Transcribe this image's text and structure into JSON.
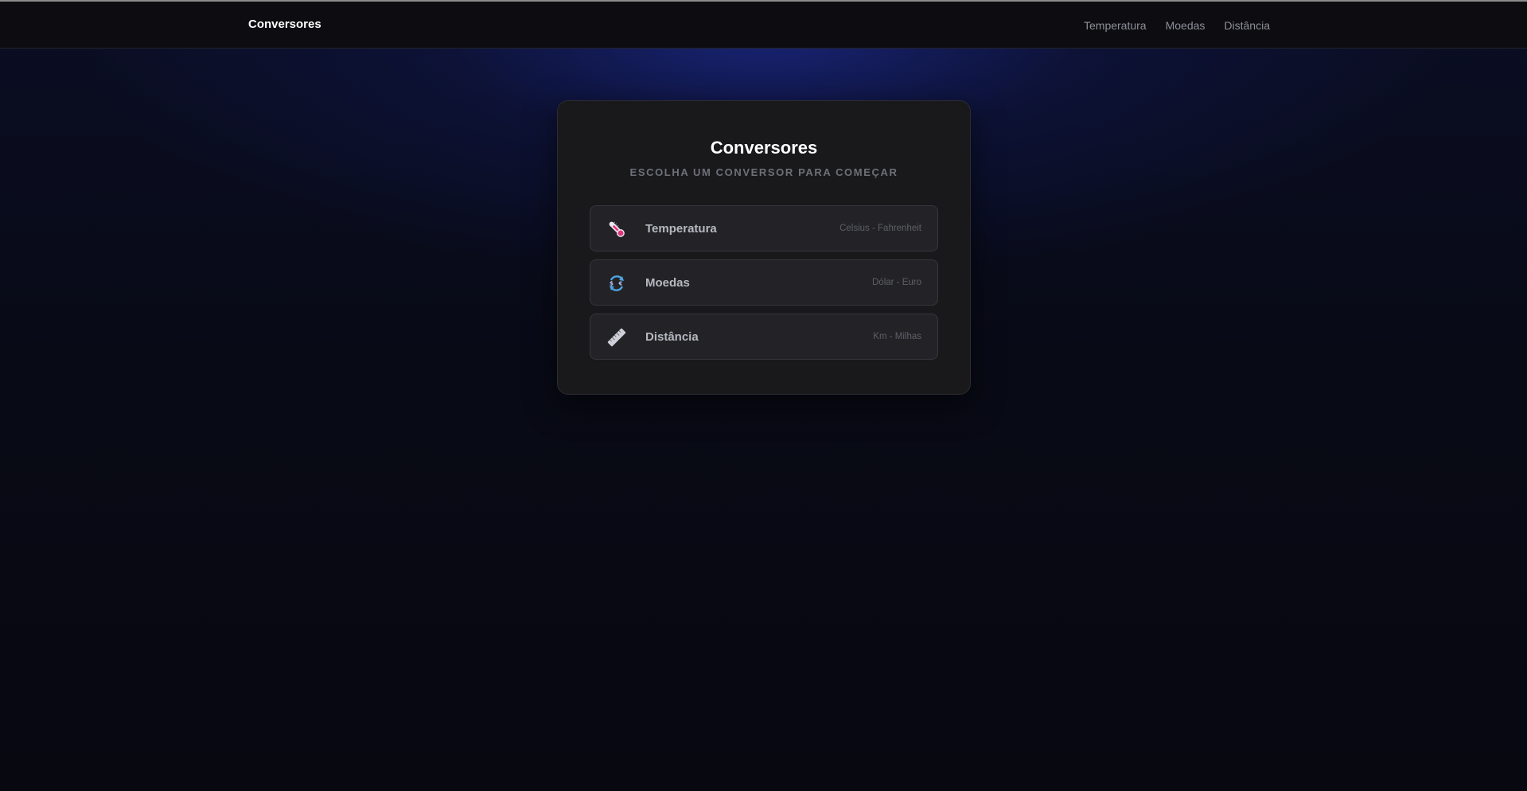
{
  "navbar": {
    "brand": "Conversores",
    "links": [
      {
        "label": "Temperatura"
      },
      {
        "label": "Moedas"
      },
      {
        "label": "Distância"
      }
    ]
  },
  "card": {
    "title": "Conversores",
    "subtitle": "ESCOLHA UM CONVERSOR PARA COMEÇAR",
    "options": [
      {
        "label": "Temperatura",
        "description": "Celsius - Fahrenheit",
        "icon": "thermometer-icon"
      },
      {
        "label": "Moedas",
        "description": "Dólar - Euro",
        "icon": "currency-exchange-icon"
      },
      {
        "label": "Distância",
        "description": "Km - Milhas",
        "icon": "ruler-icon"
      }
    ]
  },
  "colors": {
    "background": "#080912",
    "accent_glow": "#1c2a8c",
    "card": "#19191c",
    "option": "#232327"
  }
}
